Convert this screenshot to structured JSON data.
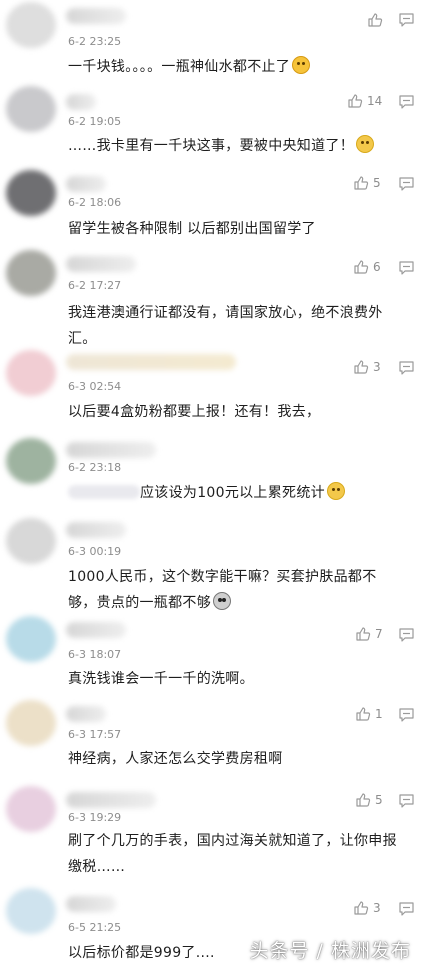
{
  "comments": [
    {
      "time": "6-2 23:25",
      "text": "一千块钱。。。。一瓶神仙水都不止了",
      "likes": "",
      "emoji": "orange"
    },
    {
      "time": "6-2 19:05",
      "text": "……我卡里有一千块这事，要被中央知道了！",
      "likes": "14",
      "emoji": "yellow"
    },
    {
      "time": "6-2 18:06",
      "text": "留学生被各种限制 以后都别出国留学了",
      "likes": "5",
      "emoji": ""
    },
    {
      "time": "6-2 17:27",
      "text": "我连港澳通行证都没有，请国家放心，绝不浪费外汇。",
      "likes": "6",
      "emoji": ""
    },
    {
      "time": "6-3 02:54",
      "text": "以后要4盒奶粉都要上报！还有！我去，",
      "likes": "3",
      "emoji": ""
    },
    {
      "time": "6-2 23:18",
      "text": "应该设为100元以上累死统计",
      "likes": "",
      "emoji": "yellow"
    },
    {
      "time": "6-3 00:19",
      "text": "1000人民币，这个数字能干嘛？买套护肤品都不够，贵点的一瓶都不够",
      "likes": "",
      "emoji": "gray"
    },
    {
      "time": "6-3 18:07",
      "text": "真洗钱谁会一千一千的洗啊。",
      "likes": "7",
      "emoji": ""
    },
    {
      "time": "6-3 17:57",
      "text": "神经病，人家还怎么交学费房租啊",
      "likes": "1",
      "emoji": ""
    },
    {
      "time": "6-3 19:29",
      "text": "刷了个几万的手表，国内过海关就知道了，让你申报缴税……",
      "likes": "5",
      "emoji": ""
    },
    {
      "time": "6-5 21:25",
      "text": "以后标价都是999了....",
      "likes": "3",
      "emoji": ""
    }
  ],
  "watermark": "头条号 / 株洲发布",
  "colors": {
    "text": "#1e1e1e",
    "meta": "#8d8d8d",
    "icon": "#9a9a9a"
  }
}
